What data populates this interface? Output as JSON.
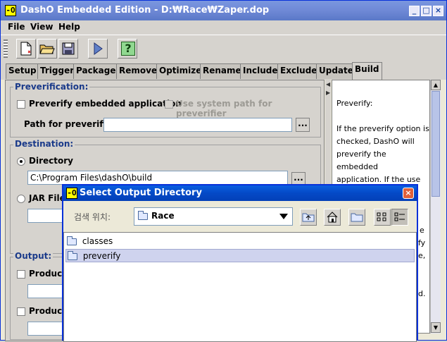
{
  "window": {
    "title": "DashO Embedded Edition - D:₩Race₩Zaper.dop",
    "icon_glyph": "-O",
    "controls": [
      "_",
      "□",
      "×"
    ]
  },
  "menu": [
    "File",
    "View",
    "Help"
  ],
  "toolbar": {
    "buttons": [
      "new-file-icon",
      "open-folder-icon",
      "save-icon",
      "run-icon",
      "help-icon"
    ],
    "help_glyph": "?"
  },
  "tabs": {
    "items": [
      "Setup",
      "Trigger",
      "Package",
      "Remove",
      "Optimize",
      "Rename",
      "Include",
      "Exclude",
      "Update",
      "Build"
    ],
    "active": "Build"
  },
  "preverification": {
    "title": "Preverification:",
    "preverify_label": "Preverify embedded application",
    "system_path_label": "Use system path for preverifier",
    "path_label": "Path for preverifier",
    "path_value": "",
    "browse": "..."
  },
  "destination": {
    "title": "Destination:",
    "directory_label": "Directory",
    "directory_value": "C:\\Program Files\\dashO\\build",
    "jar_label": "JAR File",
    "browse": "..."
  },
  "output": {
    "title": "Output:",
    "produce1": "Produce",
    "produce2": "Produce"
  },
  "help_panel": {
    "lines": [
      "Preverify:",
      "",
      "If the preverify option is",
      "checked, DashO will",
      "preverify the",
      "embedded",
      "application. If the use"
    ],
    "peek": [
      "e",
      "fy",
      "e,",
      "d."
    ]
  },
  "dialog": {
    "title": "Select Output Directory",
    "icon_glyph": "-O",
    "look_in_label": "검색 위치:",
    "look_in_value": "Race",
    "buttons": [
      "up-folder-icon",
      "home-icon",
      "new-folder-icon",
      "list-view-icon",
      "details-view-icon"
    ],
    "files": [
      {
        "name": "classes",
        "selected": false
      },
      {
        "name": "preverify",
        "selected": true
      }
    ]
  },
  "colors": {
    "titlebar": "#7a96df",
    "dialog_titlebar": "#0449c6",
    "group_title": "#1a3a8a",
    "selection": "#cfd3ee"
  }
}
